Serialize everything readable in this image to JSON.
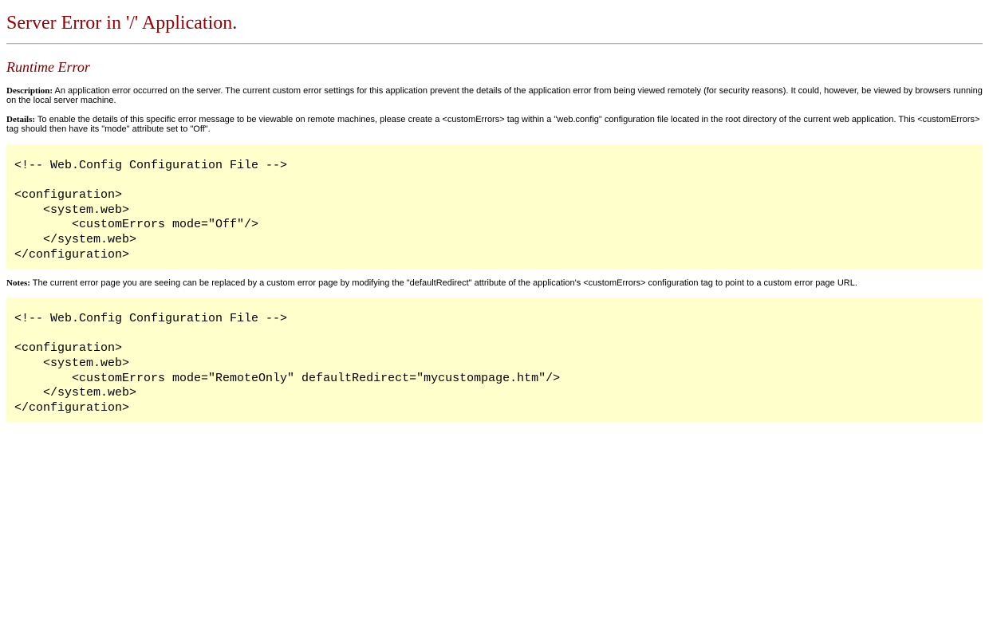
{
  "page": {
    "title": "Server Error in '/' Application.",
    "error_type": "Runtime Error"
  },
  "description": {
    "label": "Description:",
    "text": " An application error occurred on the server. The current custom error settings for this application prevent the details of the application error from being viewed remotely (for security reasons). It could, however, be viewed by browsers running on the local server machine."
  },
  "details": {
    "label": "Details:",
    "text": " To enable the details of this specific error message to be viewable on remote machines, please create a <customErrors> tag within a \"web.config\" configuration file located in the root directory of the current web application. This <customErrors> tag should then have its \"mode\" attribute set to \"Off\"."
  },
  "code_sample_1": {
    "text": "<!-- Web.Config Configuration File -->\n\n<configuration>\n    <system.web>\n        <customErrors mode=\"Off\"/>\n    </system.web>\n</configuration>"
  },
  "notes": {
    "label": "Notes:",
    "text": " The current error page you are seeing can be replaced by a custom error page by modifying the \"defaultRedirect\" attribute of the application's <customErrors> configuration tag to point to a custom error page URL."
  },
  "code_sample_2": {
    "text": "<!-- Web.Config Configuration File -->\n\n<configuration>\n    <system.web>\n        <customErrors mode=\"RemoteOnly\" defaultRedirect=\"mycustompage.htm\"/>\n    </system.web>\n</configuration>"
  },
  "colors": {
    "title": "#990000",
    "heading": "#800000",
    "code_background": "#ffffcc"
  }
}
